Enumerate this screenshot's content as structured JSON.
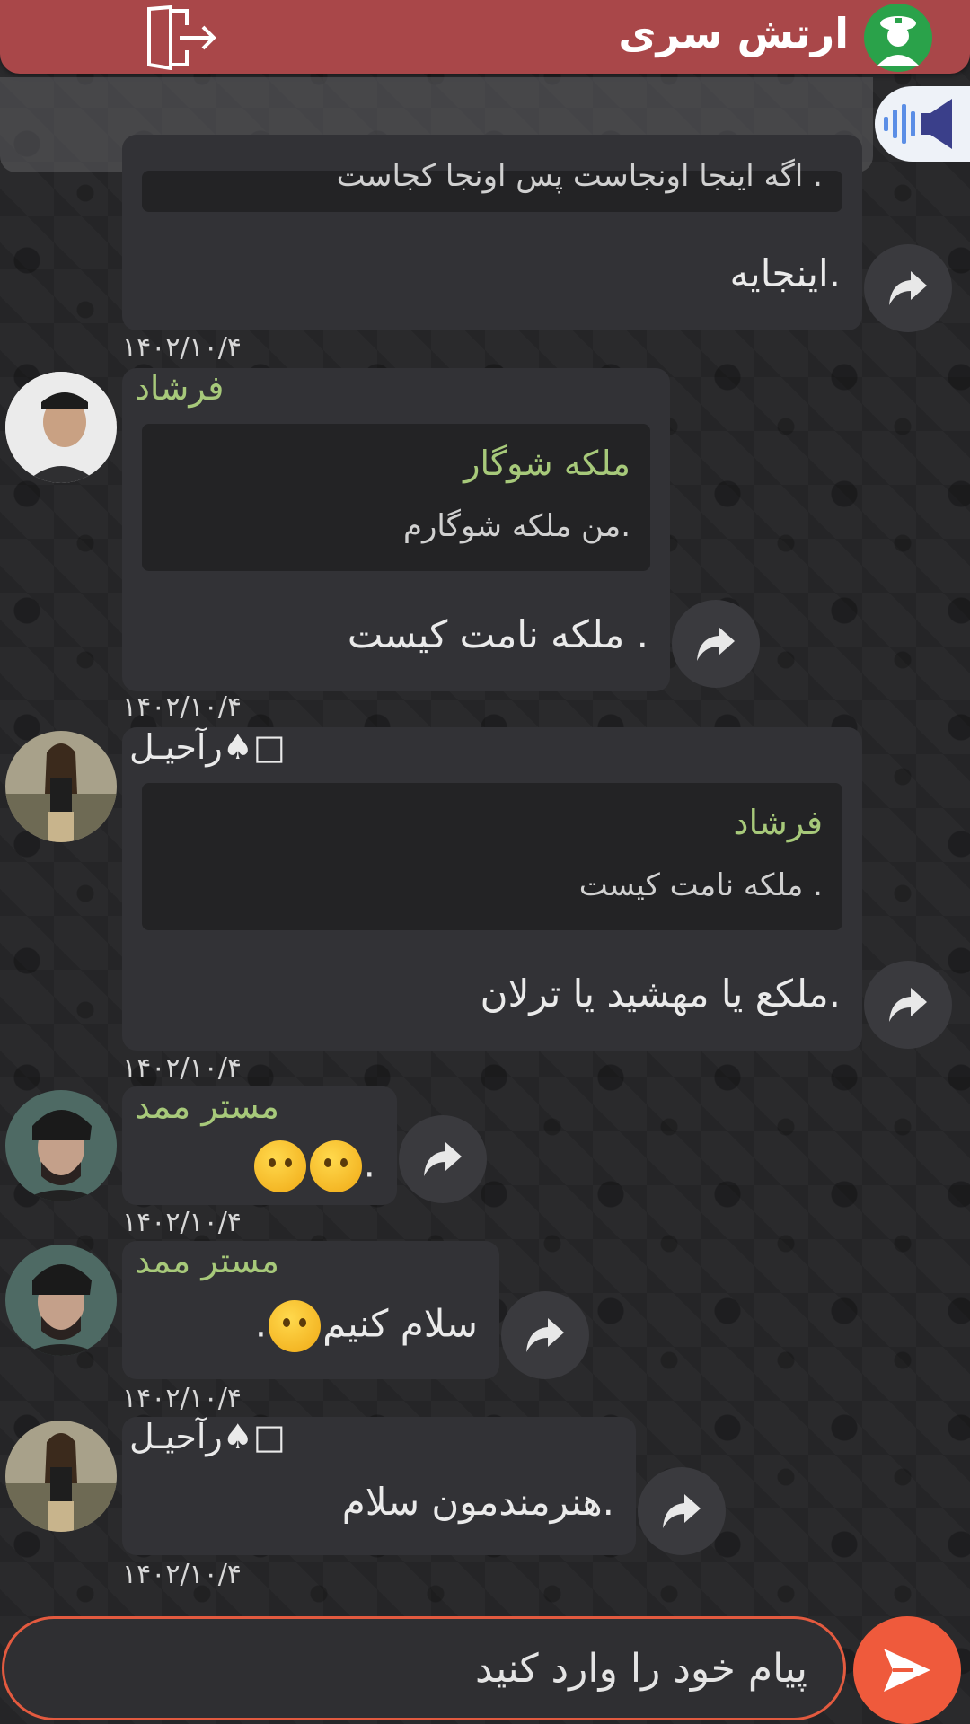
{
  "header": {
    "title": "ارتش سری",
    "logo_icon": "soldier-avatar-icon",
    "exit_icon": "exit-door-icon"
  },
  "pinned": {
    "partial_text": "اگه اینجا اونجاست پس اونجا کجاست .",
    "icon": "voice-wave-icon"
  },
  "messages": [
    {
      "text": "اینجایه.",
      "date": "۱۴۰۲/۱۰/۴"
    },
    {
      "sender": "فرشاد",
      "quote_name": "ملکه شوگار",
      "quote_text": "من ملکه شوگارم.",
      "text": "ملکه نامت کیست .",
      "date": "۱۴۰۲/۱۰/۴"
    },
    {
      "sender": "رآحیـل♠□",
      "quote_name": "فرشاد",
      "quote_text": "ملکه نامت کیست .",
      "text": "ملکع  یا مهشید یا ترلان.",
      "date": "۱۴۰۲/۱۰/۴"
    },
    {
      "sender": "مستر ممد",
      "text": ".",
      "date": "۱۴۰۲/۱۰/۴"
    },
    {
      "sender": "مستر ممد",
      "text": "سلام کنیم",
      "suffix": ".",
      "date": "۱۴۰۲/۱۰/۴"
    },
    {
      "sender": "رآحیـل♠□",
      "text": "هنرمندمون سلام.",
      "date": "۱۴۰۲/۱۰/۴"
    }
  ],
  "composer": {
    "placeholder": "پیام خود را وارد کنید",
    "send_icon": "send-arrow-icon"
  },
  "colors": {
    "header": "#a94749",
    "sender_name": "#a7c97a",
    "send_button": "#ef5a3c"
  }
}
